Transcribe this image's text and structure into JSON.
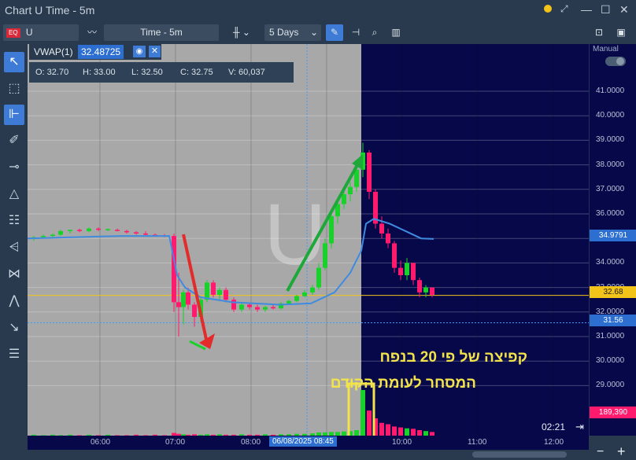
{
  "window": {
    "title": "Chart U Time - 5m"
  },
  "toolbar": {
    "exchange_badge": "EQ",
    "symbol": "U",
    "timeframe": "Time - 5m",
    "range": "5 Days",
    "mode": "Manual"
  },
  "indicator": {
    "name": "VWAP(1)",
    "value": "32.48725"
  },
  "ohlcv": {
    "open": "O:  32.70",
    "high": "H:  33.00",
    "low": "L:  32.50",
    "close": "C:  32.75",
    "volume": "V:  60,037"
  },
  "price_axis": {
    "labels": [
      "41.0000",
      "40.0000",
      "39.0000",
      "38.0000",
      "37.0000",
      "36.0000",
      "35.0000",
      "34.0000",
      "33.0000",
      "32.0000",
      "31.0000",
      "30.0000",
      "29.0000"
    ],
    "vwap_tag": "34.9791",
    "last_price_tag": "32.68",
    "crosshair_tag": "31.56",
    "volume_tag": "189,390"
  },
  "time_axis": {
    "labels": [
      "06:00",
      "07:00",
      "08:00",
      "10:00",
      "11:00",
      "12:00"
    ],
    "crosshair_time": "06/08/2025 08:45",
    "countdown": "02:21"
  },
  "annotation": {
    "line1": "קפיצה של פי 20 בנפח",
    "line2": "המסחר לעומת הקודם"
  },
  "watermark": "U",
  "colors": {
    "up": "#19d12a",
    "down": "#ff1a6e",
    "vwap": "#3f8be0",
    "annotation": "#f2e34b",
    "navy": "#07084a",
    "gray_session": "#a8a8a8"
  },
  "chart_data": {
    "type": "candlestick",
    "series": [
      {
        "name": "VWAP(1)",
        "current": 32.48725
      }
    ],
    "ylim": [
      28.0,
      42.0
    ],
    "x_ticks": [
      "06:00",
      "07:00",
      "08:00",
      "09:00",
      "10:00",
      "11:00",
      "12:00"
    ],
    "last_price": 32.68,
    "vwap_last": 34.9791,
    "peak_high": 38.9,
    "volume_peak": 189390
  }
}
